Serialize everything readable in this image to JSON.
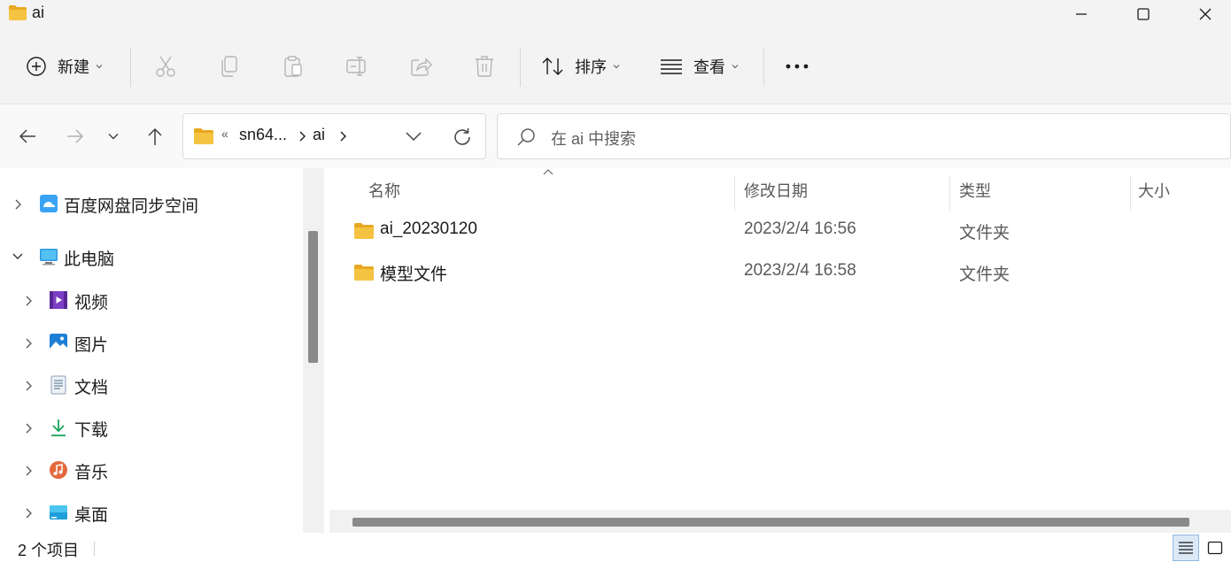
{
  "window": {
    "title": "ai",
    "minimize_icon": "minimize-icon",
    "maximize_icon": "maximize-icon",
    "close_icon": "close-icon"
  },
  "toolbar": {
    "new_label": "新建",
    "sort_label": "排序",
    "view_label": "查看",
    "more_icon": "more-icon",
    "disabled_actions": [
      "cut-icon",
      "copy-icon",
      "paste-icon",
      "rename-icon",
      "share-icon",
      "delete-icon"
    ]
  },
  "address": {
    "overflow": "«",
    "segments": [
      "sn64...",
      "ai"
    ],
    "separator": "›"
  },
  "search": {
    "placeholder": "在 ai 中搜索"
  },
  "nav": {
    "items": [
      {
        "label": "百度网盘同步空间",
        "icon": "baidu-netdisk-icon",
        "level": 0,
        "expanded": false
      },
      {
        "label": "此电脑",
        "icon": "this-pc-icon",
        "level": 0,
        "expanded": true
      },
      {
        "label": "视频",
        "icon": "videos-icon",
        "level": 1,
        "expanded": false
      },
      {
        "label": "图片",
        "icon": "pictures-icon",
        "level": 1,
        "expanded": false
      },
      {
        "label": "文档",
        "icon": "documents-icon",
        "level": 1,
        "expanded": false
      },
      {
        "label": "下载",
        "icon": "downloads-icon",
        "level": 1,
        "expanded": false
      },
      {
        "label": "音乐",
        "icon": "music-icon",
        "level": 1,
        "expanded": false
      },
      {
        "label": "桌面",
        "icon": "desktop-icon",
        "level": 1,
        "expanded": false
      }
    ]
  },
  "columns": {
    "name": "名称",
    "date": "修改日期",
    "type": "类型",
    "size": "大小"
  },
  "files": [
    {
      "name": "ai_20230120",
      "date": "2023/2/4 16:56",
      "type": "文件夹"
    },
    {
      "name": "模型文件",
      "date": "2023/2/4 16:58",
      "type": "文件夹"
    }
  ],
  "status": {
    "count": "2 个项目"
  },
  "colors": {
    "folder": "#f5c342",
    "accent": "#0067c0",
    "chrome": "#f3f3f3"
  }
}
